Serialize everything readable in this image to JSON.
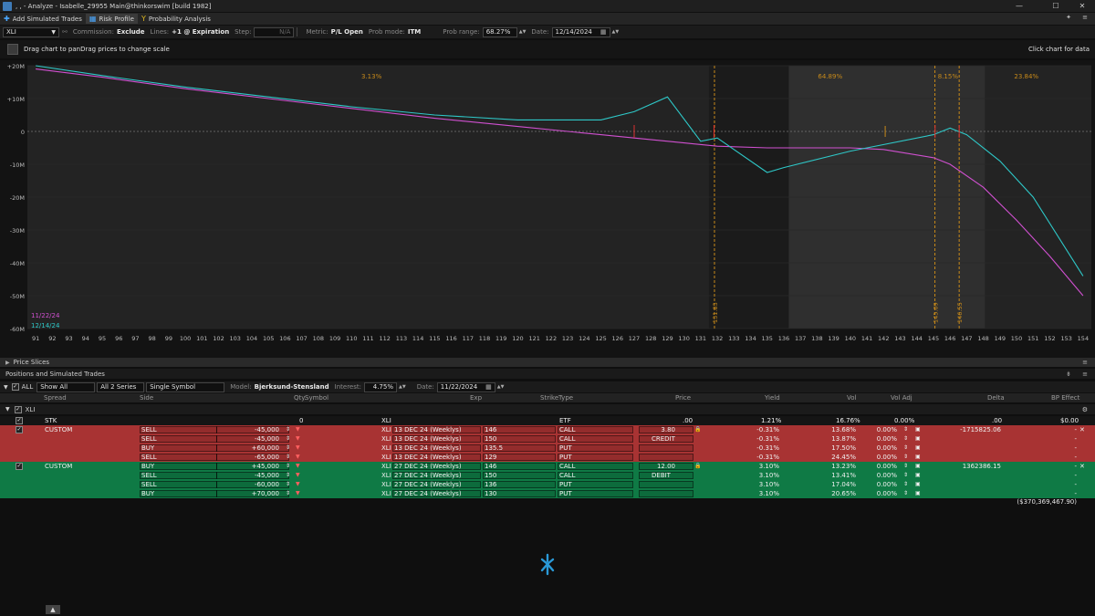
{
  "window": {
    "title": ", , - Analyze - Isabelle_29955 Main@thinkorswim [build 1982]"
  },
  "toolbar": {
    "add_simulated": "Add Simulated Trades",
    "risk_profile": "Risk Profile",
    "probability": "Probability Analysis"
  },
  "controls": {
    "symbol": "XLI",
    "commission_label": "Commission:",
    "commission_value": "Exclude",
    "lines_label": "Lines:",
    "lines_value": "+1 @ Expiration",
    "step_label": "Step:",
    "step_value": "N/A",
    "metric_label": "Metric:",
    "metric_value": "P/L Open",
    "prob_mode_label": "Prob mode:",
    "prob_mode_value": "ITM",
    "prob_range_label": "Prob range:",
    "prob_range_value": "68.27%",
    "date_label": "Date:",
    "date_value": "12/14/2024"
  },
  "hint": {
    "drag": "Drag chart to panDrag prices to change scale",
    "click": "Click chart for data"
  },
  "chart_data": {
    "type": "line",
    "ylim": [
      -60,
      20
    ],
    "y_tick_labels": [
      "+20M",
      "+10M",
      "0",
      "-10M",
      "-20M",
      "-30M",
      "-40M",
      "-50M",
      "-60M"
    ],
    "x_tick_labels": [
      "91",
      "92",
      "93",
      "94",
      "95",
      "96",
      "97",
      "98",
      "99",
      "100",
      "101",
      "102",
      "103",
      "104",
      "105",
      "106",
      "107",
      "108",
      "109",
      "110",
      "111",
      "112",
      "113",
      "114",
      "115",
      "116",
      "117",
      "118",
      "119",
      "120",
      "121",
      "122",
      "123",
      "124",
      "125",
      "126",
      "127",
      "128",
      "129",
      "130",
      "131",
      "132",
      "133",
      "134",
      "135",
      "136",
      "137",
      "138",
      "139",
      "140",
      "141",
      "142",
      "143",
      "144",
      "145",
      "146",
      "147",
      "148",
      "149",
      "150",
      "151",
      "152",
      "153",
      "154"
    ],
    "xlim": [
      90.5,
      154.5
    ],
    "series": [
      {
        "name": "11/22/24",
        "color": "#d050d0",
        "x": [
          91,
          95,
          100,
          105,
          110,
          115,
          120,
          125,
          127,
          130,
          132,
          135,
          140,
          142,
          145,
          146,
          148,
          150,
          152,
          154
        ],
        "y": [
          19,
          16.5,
          13,
          10,
          7,
          4,
          1.5,
          -1,
          -2,
          -3.5,
          -4.5,
          -5,
          -5,
          -5.5,
          -8,
          -10,
          -17,
          -27,
          -38,
          -50
        ]
      },
      {
        "name": "12/14/24",
        "color": "#2ec8c8",
        "x": [
          91,
          95,
          100,
          105,
          110,
          115,
          120,
          125,
          127,
          129,
          131,
          132,
          135,
          136,
          140,
          145,
          146,
          147,
          149,
          151,
          154
        ],
        "y": [
          20,
          17,
          13.5,
          10.5,
          7.5,
          5,
          3.5,
          3.5,
          6,
          10.5,
          -3,
          -2,
          -12.5,
          -11,
          -6,
          -1,
          1,
          -1,
          -9,
          -20,
          -44
        ]
      }
    ],
    "prob_zones": [
      {
        "label": "3.13%",
        "x_from": 90.5,
        "x_to": 131.5,
        "shade": "dark"
      },
      {
        "label": "64.89%",
        "x_from": 136.3,
        "x_to": 145.1,
        "shade": "light"
      },
      {
        "label": "8.15%",
        "x_from": 145.1,
        "x_to": 148.1,
        "shade": "light"
      },
      {
        "label": "23.84%",
        "x_from": 148.1,
        "x_to": 154.5,
        "shade": "dark"
      }
    ],
    "vlines": [
      {
        "x": 131.83,
        "label": "131.83"
      },
      {
        "x": 145.09,
        "label": "145.09"
      },
      {
        "x": 146.55,
        "label": "146.55"
      }
    ],
    "markers_red": [
      127,
      131.8,
      145.1,
      146.55
    ],
    "marker_orange": 142.1,
    "legend": [
      "11/22/24",
      "12/14/24"
    ]
  },
  "slices": {
    "label": "Price Slices"
  },
  "positions": {
    "title": "Positions and Simulated Trades",
    "show": "Show All",
    "series": "All 2 Series",
    "single": "Single Symbol",
    "model_label": "Model:",
    "model_value": "Bjerksund-Stensland",
    "interest_label": "Interest:",
    "interest_value": "4.75%",
    "date_label": "Date:",
    "date_value": "11/22/2024",
    "all_label": "ALL",
    "columns": [
      "Spread",
      "Side",
      "Qty.",
      "Symbol",
      "Exp",
      "Strike",
      "Type",
      "Price",
      "Yield",
      "Vol",
      "Vol Adj",
      "Delta",
      "BP Effect"
    ],
    "group": "XLI",
    "stock_row": {
      "spread": "STK",
      "qty": "0",
      "symbol": "XLI",
      "type": "ETF",
      "price": ".00",
      "yield": "1.21%",
      "vol": "16.76%",
      "voladj": "0.00%",
      "delta": ".00",
      "bp": "$0.00"
    },
    "red_rows": [
      {
        "spread": "CUSTOM",
        "side": "SELL",
        "qty": "-45,000",
        "symbol": "XLI",
        "exp": "13 DEC 24 (Weeklys)",
        "strike": "146",
        "type": "CALL",
        "price": "3.80",
        "yield": "-0.31%",
        "vol": "13.68%",
        "voladj": "0.00%",
        "delta": "-1715825.06",
        "bp": "-"
      },
      {
        "spread": "",
        "side": "SELL",
        "qty": "-45,000",
        "symbol": "XLI",
        "exp": "13 DEC 24 (Weeklys)",
        "strike": "150",
        "type": "CALL",
        "price": "CREDIT",
        "yield": "-0.31%",
        "vol": "13.87%",
        "voladj": "0.00%",
        "delta": "",
        "bp": "-"
      },
      {
        "spread": "",
        "side": "BUY",
        "qty": "+60,000",
        "symbol": "XLI",
        "exp": "13 DEC 24 (Weeklys)",
        "strike": "135.5",
        "type": "PUT",
        "price": "",
        "yield": "-0.31%",
        "vol": "17.50%",
        "voladj": "0.00%",
        "delta": "",
        "bp": "-"
      },
      {
        "spread": "",
        "side": "SELL",
        "qty": "-65,000",
        "symbol": "XLI",
        "exp": "13 DEC 24 (Weeklys)",
        "strike": "129",
        "type": "PUT",
        "price": "",
        "yield": "-0.31%",
        "vol": "24.45%",
        "voladj": "0.00%",
        "delta": "",
        "bp": "-"
      }
    ],
    "green_rows": [
      {
        "spread": "CUSTOM",
        "side": "BUY",
        "qty": "+45,000",
        "symbol": "XLI",
        "exp": "27 DEC 24 (Weeklys)",
        "strike": "146",
        "type": "CALL",
        "price": "12.00",
        "yield": "3.10%",
        "vol": "13.23%",
        "voladj": "0.00%",
        "delta": "1362386.15",
        "bp": "-"
      },
      {
        "spread": "",
        "side": "SELL",
        "qty": "-45,000",
        "symbol": "XLI",
        "exp": "27 DEC 24 (Weeklys)",
        "strike": "150",
        "type": "CALL",
        "price": "DEBIT",
        "yield": "3.10%",
        "vol": "13.41%",
        "voladj": "0.00%",
        "delta": "",
        "bp": "-"
      },
      {
        "spread": "",
        "side": "SELL",
        "qty": "-60,000",
        "symbol": "XLI",
        "exp": "27 DEC 24 (Weeklys)",
        "strike": "136",
        "type": "PUT",
        "price": "",
        "yield": "3.10%",
        "vol": "17.04%",
        "voladj": "0.00%",
        "delta": "",
        "bp": "-"
      },
      {
        "spread": "",
        "side": "BUY",
        "qty": "+70,000",
        "symbol": "XLI",
        "exp": "27 DEC 24 (Weeklys)",
        "strike": "130",
        "type": "PUT",
        "price": "",
        "yield": "3.10%",
        "vol": "20.65%",
        "voladj": "0.00%",
        "delta": "",
        "bp": "-"
      }
    ],
    "total_bp": "($370,369,467.90)"
  }
}
